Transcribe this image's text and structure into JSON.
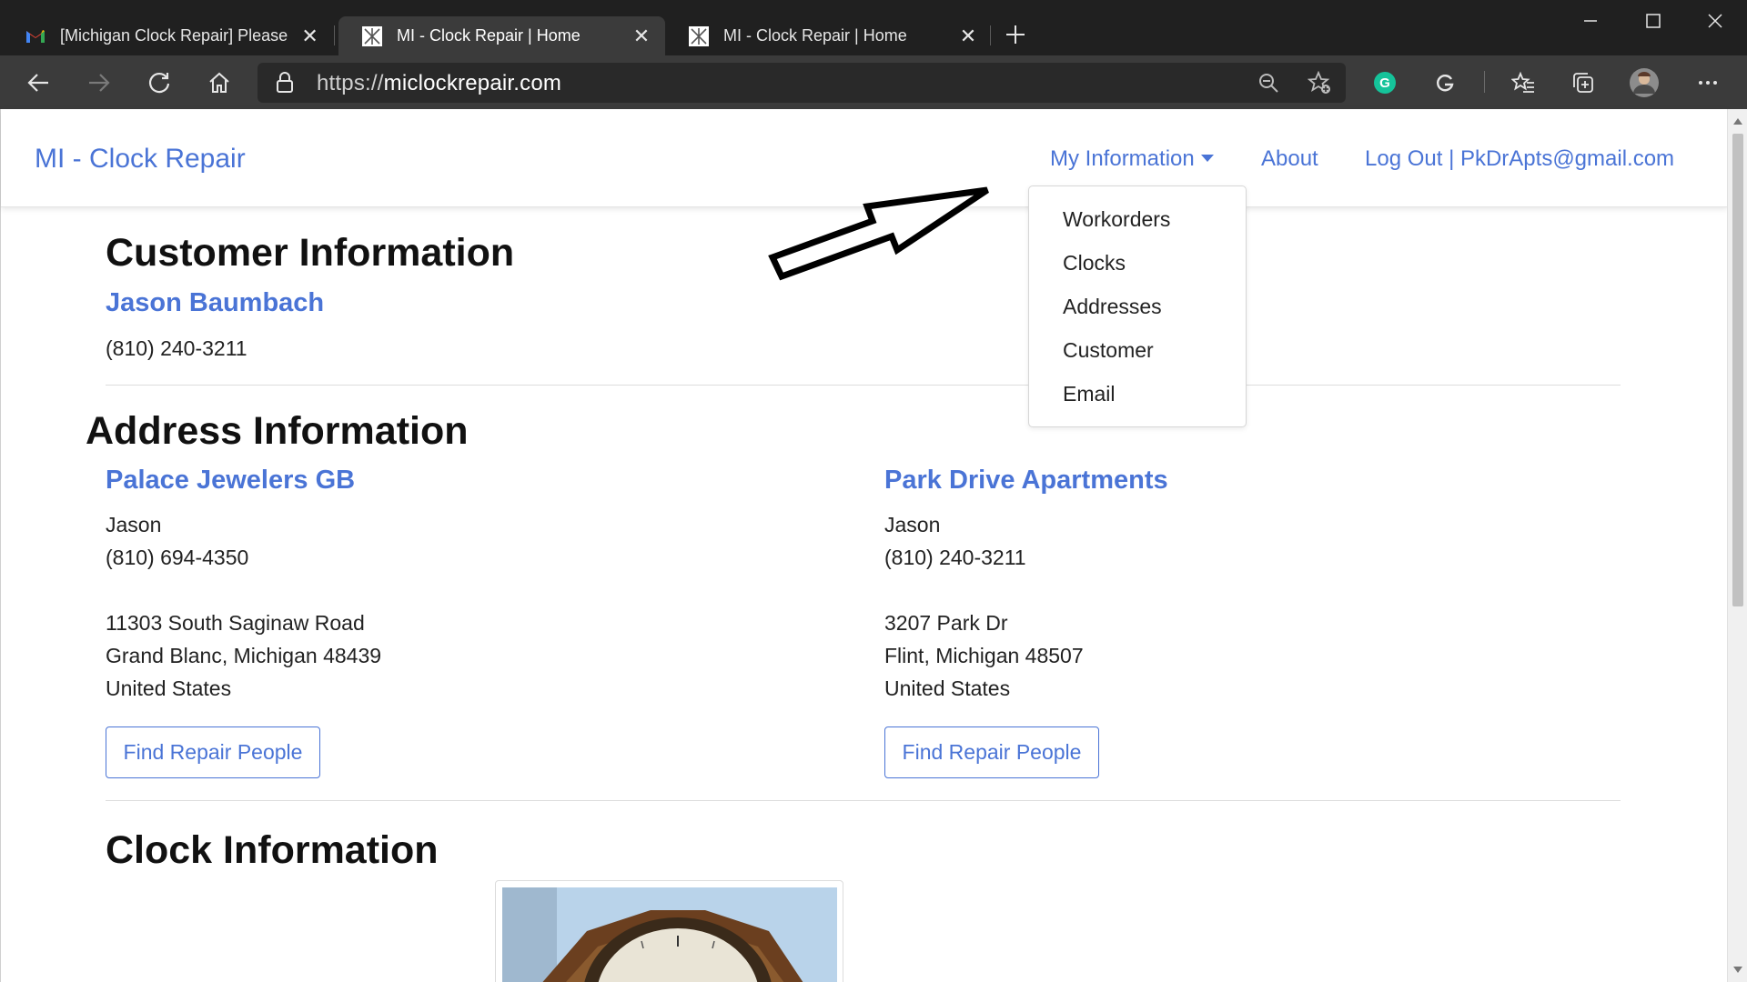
{
  "browser": {
    "tabs": [
      {
        "title": "[Michigan Clock Repair] Please C",
        "favicon": "gmail-icon",
        "active": false
      },
      {
        "title": "MI - Clock Repair | Home",
        "favicon": "site-icon",
        "active": true
      },
      {
        "title": "MI - Clock Repair | Home",
        "favicon": "site-icon",
        "active": false
      }
    ],
    "address_bar": {
      "scheme": "https://",
      "host": "miclockrepair.com"
    }
  },
  "navbar": {
    "brand": "MI - Clock Repair",
    "my_information": "My Information",
    "about": "About",
    "logout": "Log Out | PkDrApts@gmail.com",
    "dropdown": [
      "Workorders",
      "Clocks",
      "Addresses",
      "Customer",
      "Email"
    ]
  },
  "customer": {
    "heading": "Customer Information",
    "name": "Jason Baumbach",
    "phone": "(810) 240-3211"
  },
  "addresses": {
    "heading": "Address Information",
    "items": [
      {
        "name": "Palace Jewelers GB",
        "contact": "Jason",
        "phone": "(810) 694-4350",
        "street": "11303 South Saginaw Road",
        "city_line": "Grand Blanc, Michigan 48439",
        "country": "United States",
        "button": "Find Repair People"
      },
      {
        "name": "Park Drive Apartments",
        "contact": "Jason",
        "phone": "(810) 240-3211",
        "street": "3207 Park Dr",
        "city_line": "Flint, Michigan 48507",
        "country": "United States",
        "button": "Find Repair People"
      }
    ]
  },
  "clock": {
    "heading": "Clock Information"
  },
  "colors": {
    "link": "#4a74d6",
    "chrome_dark": "#202020",
    "chrome_toolbar": "#3b3b3b"
  }
}
